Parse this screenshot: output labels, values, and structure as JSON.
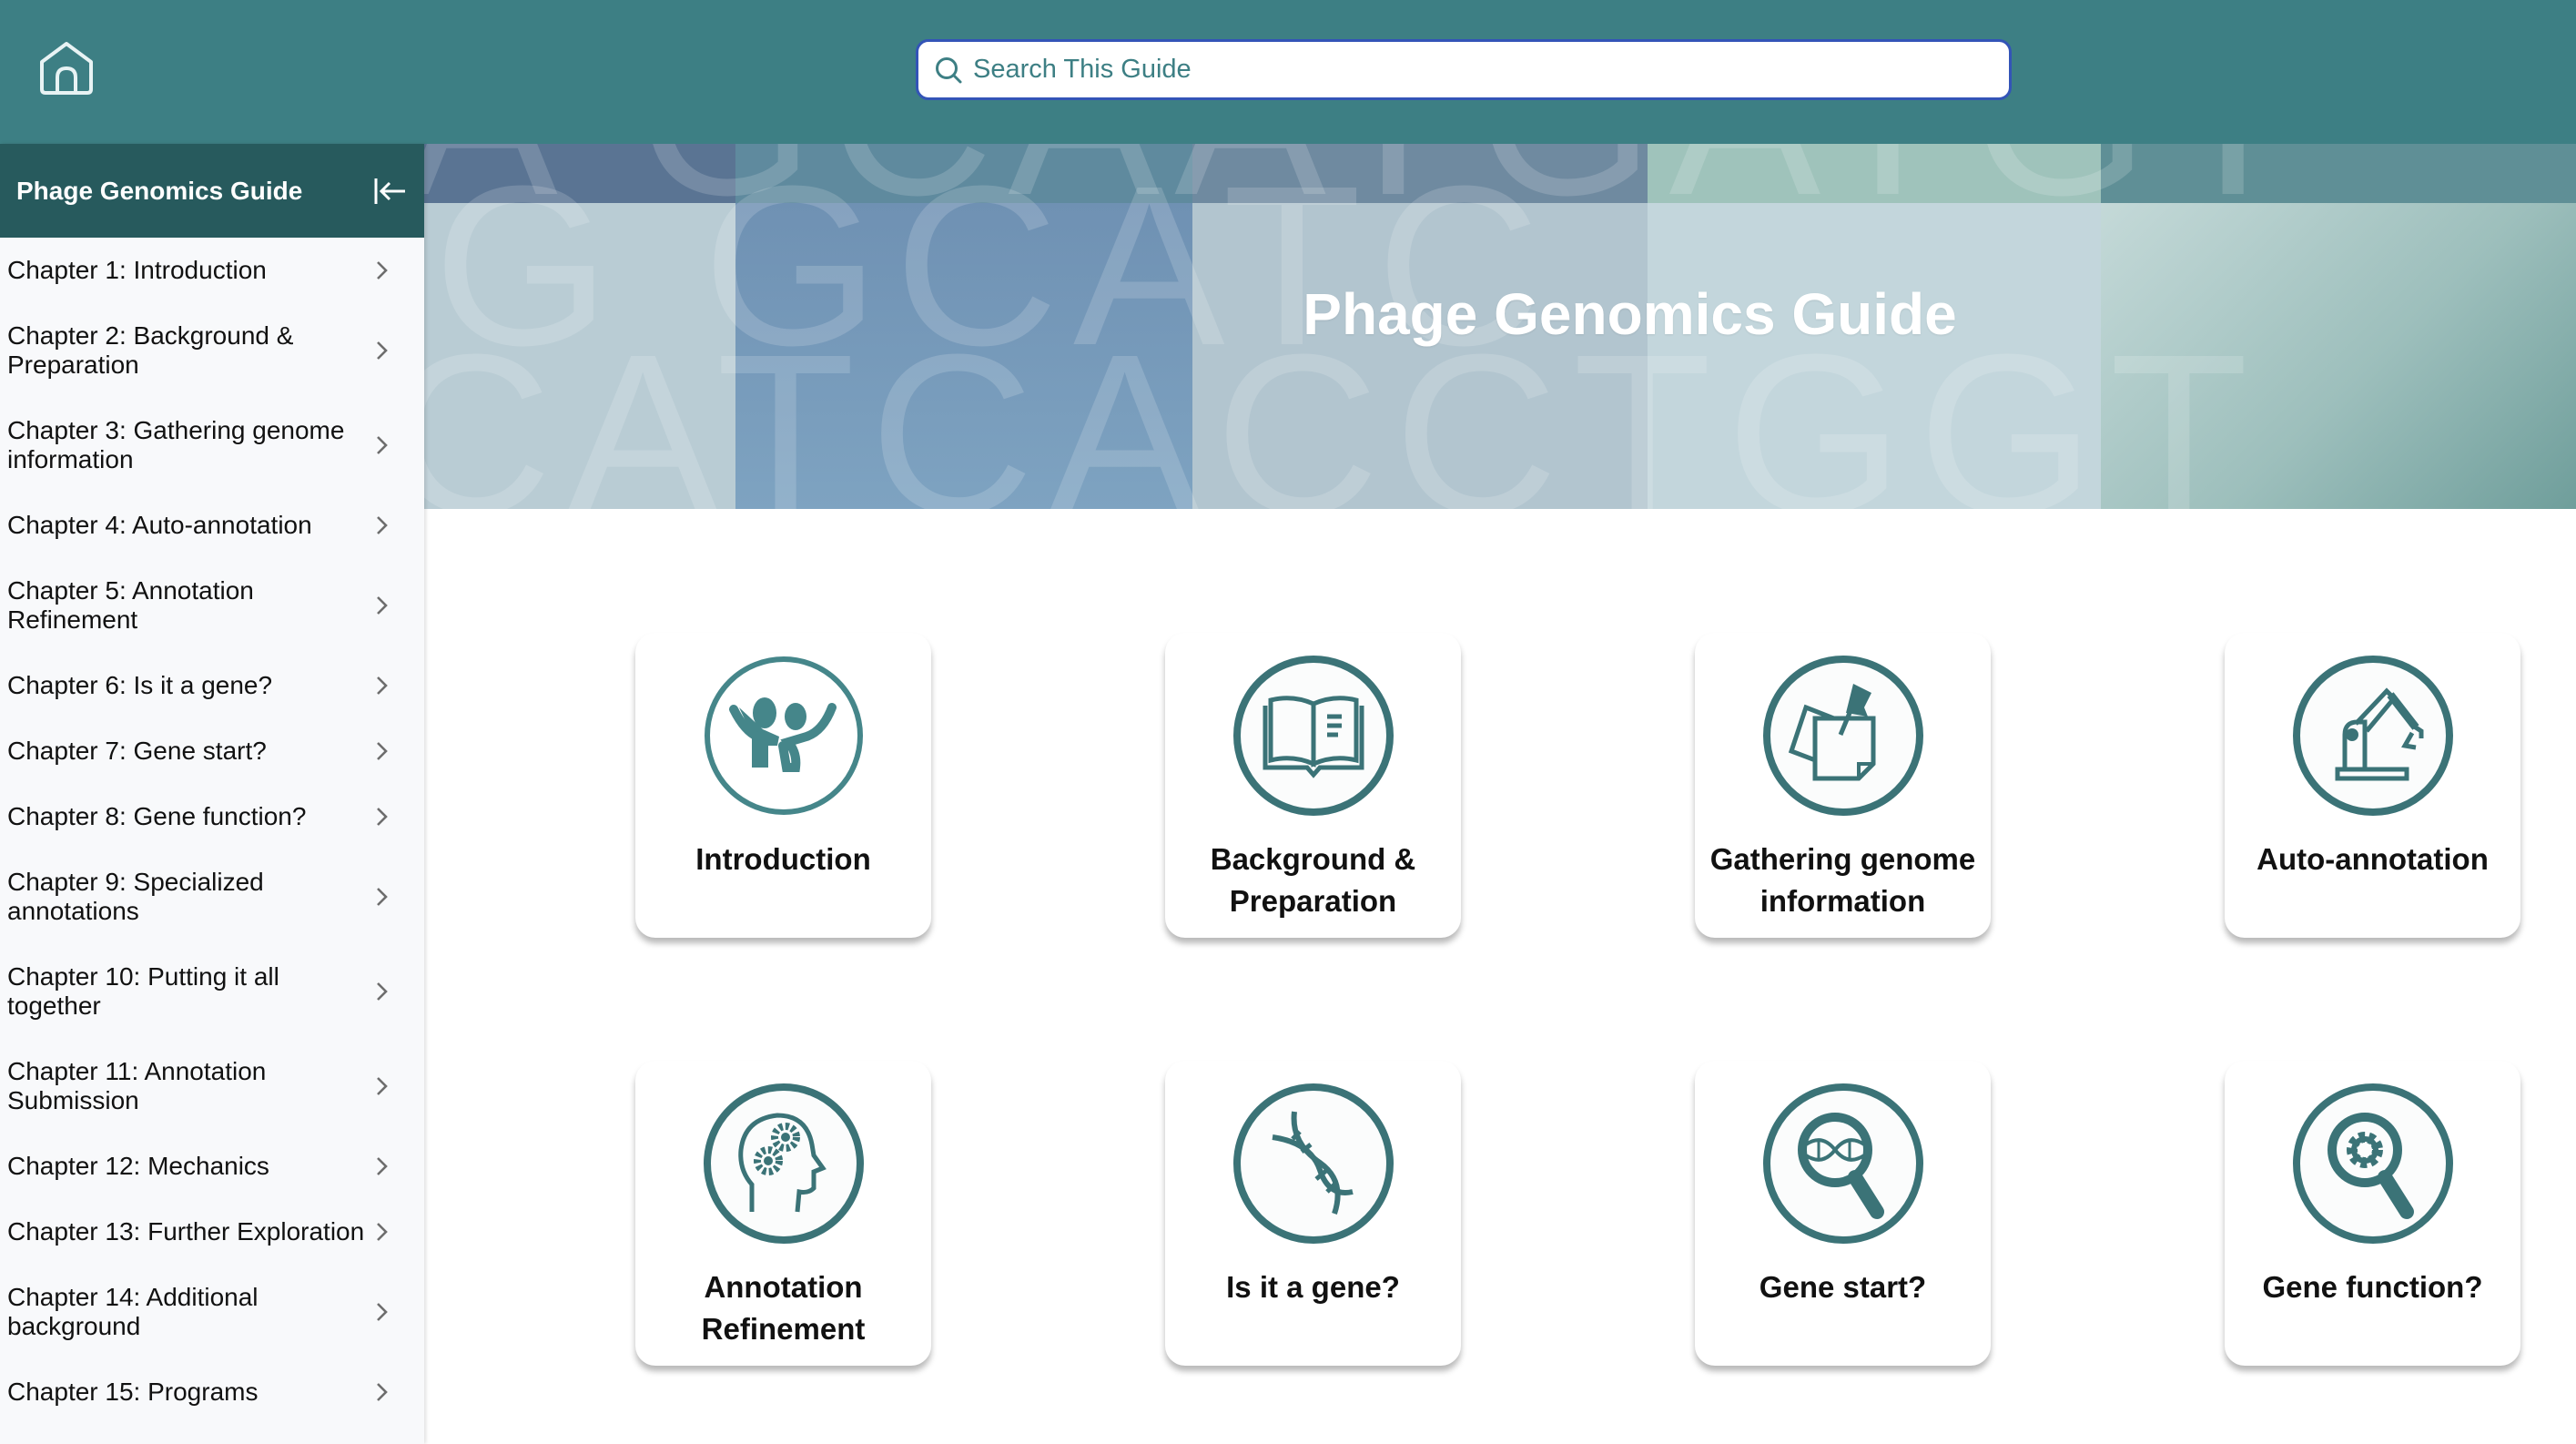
{
  "header": {
    "home_icon": "home-icon",
    "search": {
      "placeholder": "Search This Guide",
      "value": "",
      "icon": "search-icon"
    }
  },
  "sidebar": {
    "title": "Phage Genomics Guide",
    "collapse_icon": "collapse-left-icon",
    "items": [
      {
        "label": "Chapter 1: Introduction",
        "lines": 1
      },
      {
        "label": "Chapter 2: Background & Preparation",
        "lines": 2
      },
      {
        "label": "Chapter 3: Gathering genome information",
        "lines": 2
      },
      {
        "label": "Chapter 4: Auto-annotation",
        "lines": 1
      },
      {
        "label": "Chapter 5: Annotation Refinement",
        "lines": 2
      },
      {
        "label": "Chapter 6: Is it a gene?",
        "lines": 1
      },
      {
        "label": "Chapter 7: Gene start?",
        "lines": 1
      },
      {
        "label": "Chapter 8: Gene function?",
        "lines": 1
      },
      {
        "label": "Chapter 9: Specialized annotations",
        "lines": 2
      },
      {
        "label": "Chapter 10: Putting it all together",
        "lines": 2
      },
      {
        "label": "Chapter 11: Annotation Submission",
        "lines": 2
      },
      {
        "label": "Chapter 12: Mechanics",
        "lines": 1
      },
      {
        "label": "Chapter 13: Further Exploration",
        "lines": 1
      },
      {
        "label": "Chapter 14: Additional background",
        "lines": 2
      },
      {
        "label": "Chapter 15: Programs",
        "lines": 1
      }
    ]
  },
  "banner": {
    "title": "Phage Genomics Guide",
    "background_letters": [
      "A",
      "GCAATGATGT",
      "G",
      "GCATC",
      "CATCACCTGGT"
    ]
  },
  "cards": [
    {
      "label": "Introduction",
      "icon": "people-cheering-icon"
    },
    {
      "label": "Background & Preparation",
      "icon": "open-book-icon"
    },
    {
      "label": "Gathering genome information",
      "icon": "pinned-notes-icon"
    },
    {
      "label": "Auto-annotation",
      "icon": "robot-arm-icon"
    },
    {
      "label": "Annotation Refinement",
      "icon": "head-gears-icon"
    },
    {
      "label": "Is it a gene?",
      "icon": "dna-icon"
    },
    {
      "label": "Gene start?",
      "icon": "dna-magnifier-icon"
    },
    {
      "label": "Gene function?",
      "icon": "gear-magnifier-icon"
    }
  ],
  "colors": {
    "header_bg": "#3d7f84",
    "sidebar_header_bg": "#275a5d",
    "sidebar_bg": "#f8f9fb",
    "icon_teal": "#3b7377",
    "search_border": "#3354b7"
  }
}
